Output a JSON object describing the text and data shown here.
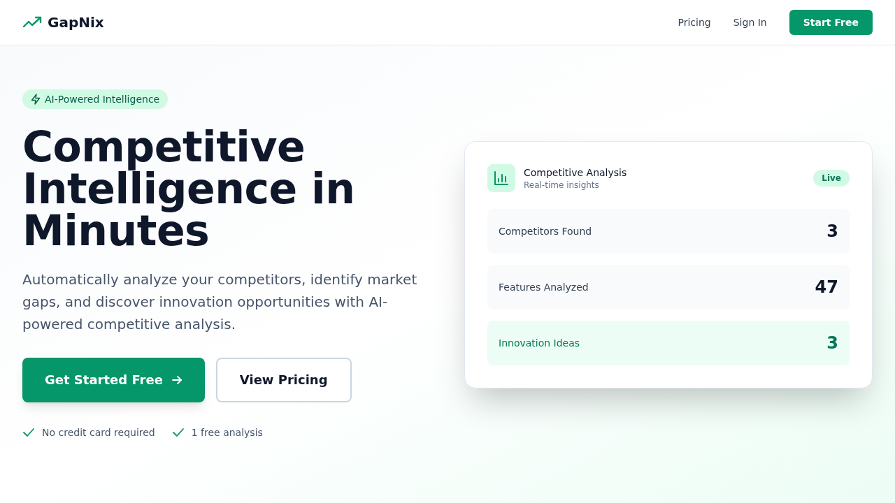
{
  "header": {
    "logo": "GapNix",
    "nav_links": [
      "Pricing",
      "Sign In"
    ],
    "cta": "Start Free"
  },
  "hero": {
    "badge": "AI-Powered Intelligence",
    "title_lines": [
      "Competitive",
      "Intelligence in",
      "Minutes"
    ],
    "description": "Automatically analyze your competitors, identify market gaps, and discover innovation opportunities with AI-powered competitive analysis.",
    "buttons": [
      {
        "label": "Get Started Free",
        "kind": "primary"
      },
      {
        "label": "View Pricing",
        "kind": "outline"
      }
    ],
    "perks": [
      "No credit card required",
      "1 free analysis"
    ]
  },
  "card": {
    "title": "Competitive Analysis",
    "subtitle": "Real-time insights",
    "badge": "Live",
    "stats": [
      {
        "label": "Competitors Found",
        "value": "3",
        "highlighted": false
      },
      {
        "label": "Features Analyzed",
        "value": "47",
        "highlighted": false
      },
      {
        "label": "Innovation Ideas",
        "value": "3",
        "highlighted": true
      }
    ]
  }
}
